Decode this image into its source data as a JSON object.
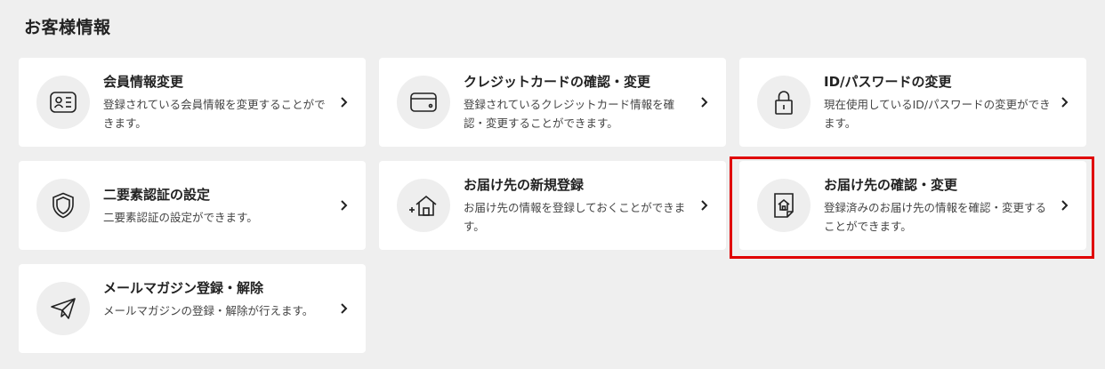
{
  "page": {
    "title": "お客様情報"
  },
  "cards": [
    {
      "title": "会員情報変更",
      "desc": "登録されている会員情報を変更することができます。",
      "icon": "member-card-icon"
    },
    {
      "title": "クレジットカードの確認・変更",
      "desc": "登録されているクレジットカード情報を確認・変更することができます。",
      "icon": "credit-card-icon"
    },
    {
      "title": "ID/パスワードの変更",
      "desc": "現在使用しているID/パスワードの変更ができます。",
      "icon": "lock-icon"
    },
    {
      "title": "二要素認証の設定",
      "desc": "二要素認証の設定ができます。",
      "icon": "shield-icon"
    },
    {
      "title": "お届け先の新規登録",
      "desc": "お届け先の情報を登録しておくことができます。",
      "icon": "add-address-icon"
    },
    {
      "title": "お届け先の確認・変更",
      "desc": "登録済みのお届け先の情報を確認・変更することができます。",
      "icon": "address-document-icon"
    },
    {
      "title": "メールマガジン登録・解除",
      "desc": "メールマガジンの登録・解除が行えます。",
      "icon": "paper-plane-icon"
    }
  ],
  "highlight_color": "#e00000"
}
